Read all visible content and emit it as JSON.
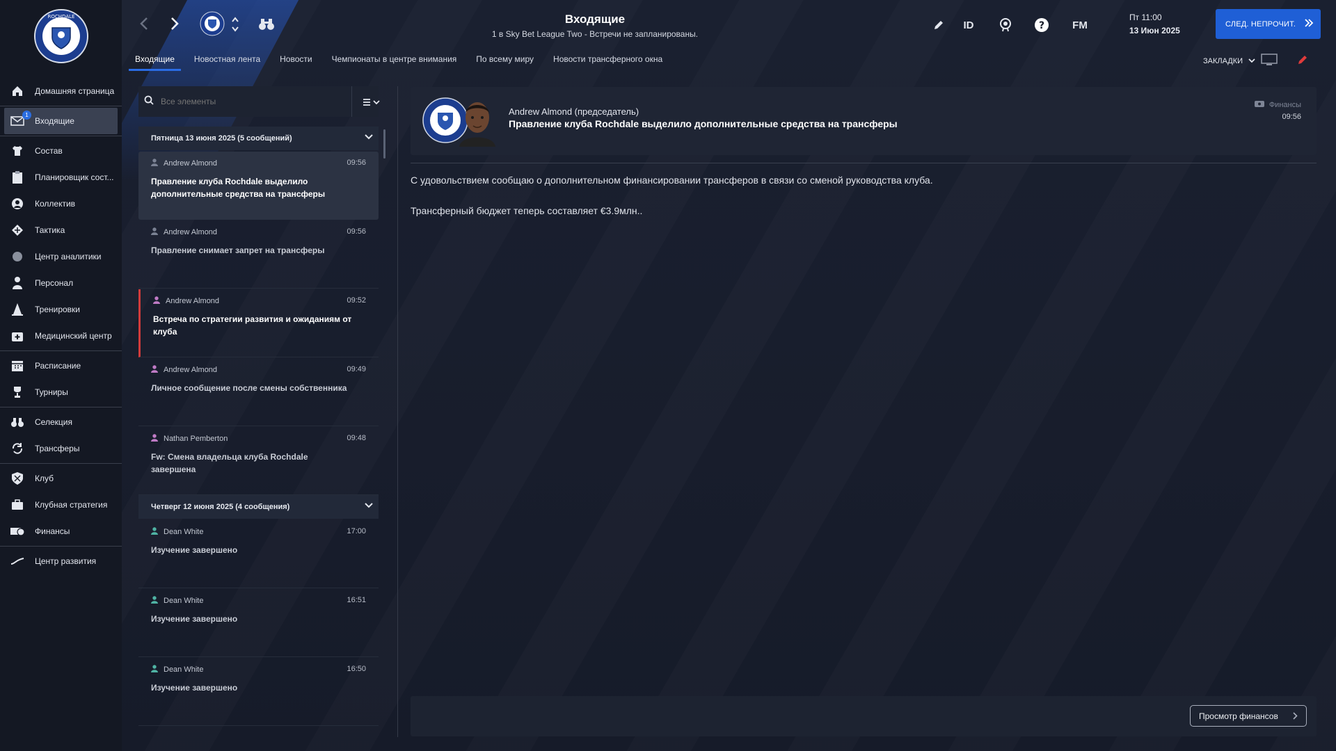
{
  "app": {
    "title": "Входящие",
    "subtitle": "1 в Sky Bet League Two - Встречи не запланированы.",
    "date_line1": "Пт 11:00",
    "date_line2": "13 Июн 2025",
    "next_button": "СЛЕД. НЕПРОЧИТ.",
    "tool_id": "ID",
    "tool_fm": "FM",
    "bookmarks": "ЗАКЛАДКИ",
    "accent_color": "#1f5fd6"
  },
  "tabs": [
    {
      "label": "Входящие",
      "active": true
    },
    {
      "label": "Новостная лента"
    },
    {
      "label": "Новости"
    },
    {
      "label": "Чемпионаты в центре внимания"
    },
    {
      "label": "По всему миру"
    },
    {
      "label": "Новости трансферного окна"
    }
  ],
  "sidebar": {
    "items": [
      {
        "label": "Домашняя страница",
        "icon": "home-icon"
      },
      {
        "label": "Входящие",
        "icon": "mail-icon",
        "badge": "1",
        "active": true
      },
      {
        "label": "Состав",
        "icon": "shirt-icon"
      },
      {
        "label": "Планировщик сост...",
        "icon": "clipboard-icon"
      },
      {
        "label": "Коллектив",
        "icon": "group-icon"
      },
      {
        "label": "Тактика",
        "icon": "tactics-icon"
      },
      {
        "label": "Центр аналитики",
        "icon": "analytics-icon"
      },
      {
        "label": "Персонал",
        "icon": "staff-icon"
      },
      {
        "label": "Тренировки",
        "icon": "cone-icon"
      },
      {
        "label": "Медицинский центр",
        "icon": "medical-icon"
      },
      {
        "label": "Расписание",
        "icon": "calendar-icon"
      },
      {
        "label": "Турниры",
        "icon": "trophy-icon"
      },
      {
        "label": "Селекция",
        "icon": "binoculars-icon"
      },
      {
        "label": "Трансферы",
        "icon": "transfer-icon"
      },
      {
        "label": "Клуб",
        "icon": "shield-icon"
      },
      {
        "label": "Клубная стратегия",
        "icon": "briefcase-icon"
      },
      {
        "label": "Финансы",
        "icon": "money-icon"
      },
      {
        "label": "Центр развития",
        "icon": "growth-icon"
      }
    ]
  },
  "search": {
    "placeholder": "Все элементы"
  },
  "groups": [
    {
      "title": "Пятница 13 июня 2025 (5 сообщений)"
    },
    {
      "title": "Четверг 12 июня 2025 (4 сообщения)"
    }
  ],
  "messages": [
    {
      "from": "Andrew Almond",
      "time": "09:56",
      "subject": "Правление клуба Rochdale выделило дополнительные средства на трансферы"
    },
    {
      "from": "Andrew Almond",
      "time": "09:56",
      "subject": "Правление снимает запрет на трансферы"
    },
    {
      "from": "Andrew Almond",
      "time": "09:52",
      "subject": "Встреча по стратегии развития и ожиданиям от клуба"
    },
    {
      "from": "Andrew Almond",
      "time": "09:49",
      "subject": "Личное сообщение после смены собственника"
    },
    {
      "from": "Nathan Pemberton",
      "time": "09:48",
      "subject": "Fw: Смена владельца клуба Rochdale завершена"
    },
    {
      "from": "Dean White",
      "time": "17:00",
      "subject": "Изучение завершено"
    },
    {
      "from": "Dean White",
      "time": "16:51",
      "subject": "Изучение завершено"
    },
    {
      "from": "Dean White",
      "time": "16:50",
      "subject": "Изучение завершено"
    }
  ],
  "detail": {
    "from": "Andrew Almond  (председатель)",
    "subject": "Правление клуба Rochdale выделило дополнительные средства на трансферы",
    "category": "Финансы",
    "time": "09:56",
    "body": [
      "С удовольствием сообщаю о дополнительном финансировании трансферов в связи со сменой руководства клуба.",
      "Трансферный бюджет теперь составляет €3.9млн.."
    ],
    "action_button": "Просмотр финансов"
  }
}
